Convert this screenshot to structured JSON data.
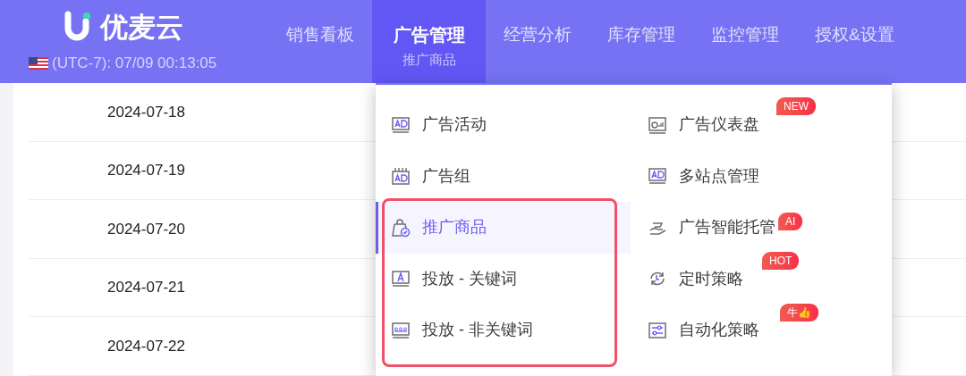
{
  "header": {
    "logo_text": "优麦云",
    "clock": "(UTC-7): 07/09 00:13:05",
    "nav": [
      {
        "label": "销售看板",
        "selected": false
      },
      {
        "label": "广告管理",
        "selected": true,
        "subtitle": "推广商品"
      },
      {
        "label": "经营分析",
        "selected": false
      },
      {
        "label": "库存管理",
        "selected": false
      },
      {
        "label": "监控管理",
        "selected": false
      },
      {
        "label": "授权&设置",
        "selected": false
      }
    ]
  },
  "table": {
    "rows": [
      "2024-07-18",
      "2024-07-19",
      "2024-07-20",
      "2024-07-21",
      "2024-07-22"
    ]
  },
  "dropdown": {
    "columns": [
      [
        {
          "label": "广告活动",
          "selected": false,
          "outlined": false
        },
        {
          "label": "广告组",
          "selected": false,
          "outlined": false
        },
        {
          "label": "推广商品",
          "selected": true,
          "outlined": true
        },
        {
          "label": "投放 - 关键词",
          "selected": false,
          "outlined": true
        },
        {
          "label": "投放 - 非关键词",
          "selected": false,
          "outlined": true
        }
      ],
      [
        {
          "label": "广告仪表盘",
          "selected": false,
          "outlined": false,
          "badge": "NEW"
        },
        {
          "label": "多站点管理",
          "selected": false,
          "outlined": false
        },
        {
          "label": "广告智能托管",
          "selected": false,
          "outlined": false,
          "badge": "AI"
        },
        {
          "label": "定时策略",
          "selected": false,
          "outlined": false,
          "badge": "HOT"
        },
        {
          "label": "自动化策略",
          "selected": false,
          "outlined": false,
          "badge": "牛👍"
        }
      ]
    ]
  }
}
